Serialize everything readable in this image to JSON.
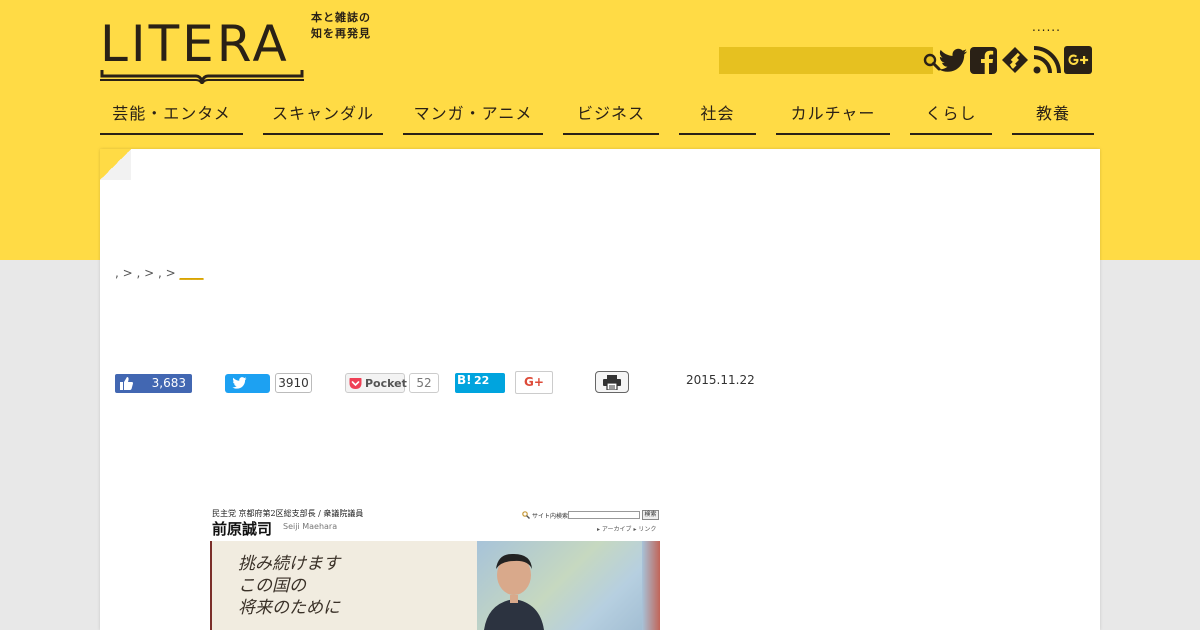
{
  "logo": {
    "word": "LITERA",
    "tagline_line1": "本と雑誌の",
    "tagline_line2": "知を再発見"
  },
  "header": {
    "dots": "......",
    "search_placeholder": ""
  },
  "social_icons": [
    "twitter-icon",
    "facebook-icon",
    "feedly-icon",
    "rss-icon",
    "google-plus-icon"
  ],
  "nav": {
    "items": [
      {
        "label": "芸能・エンタメ"
      },
      {
        "label": "スキャンダル"
      },
      {
        "label": "マンガ・アニメ"
      },
      {
        "label": "ビジネス"
      },
      {
        "label": "社会"
      },
      {
        "label": "カルチャー"
      },
      {
        "label": "くらし"
      },
      {
        "label": "教養"
      }
    ]
  },
  "breadcrumb": {
    "separator1": " > ",
    "separator2": " > ",
    "separator3": " > ",
    "comma": ",",
    "current": "____"
  },
  "share": {
    "like_count": "3,683",
    "tweet_count": "3910",
    "pocket_label": "Pocket",
    "pocket_count": "52",
    "hatena_b": "B!",
    "hatena_count": "22",
    "gplus_label": "G+"
  },
  "article": {
    "date": "2015.11.22"
  },
  "article_image": {
    "party_line": "民主党 京都府第2区総支部長 / 衆議院議員",
    "name": "前原誠司",
    "roman": "Seiji Maehara",
    "search_label": "サイト内検索",
    "search_button": "検索",
    "links": "▸ アーカイブ  ▸ リンク",
    "copy_line1": "挑み続けます",
    "copy_line2": "この国の",
    "copy_line3": "将来のために"
  },
  "colors": {
    "brand_yellow": "#ffdb45",
    "dark": "#2a2116",
    "facebook": "#4267b2",
    "twitter": "#1da1f2",
    "hatena": "#00a4de",
    "gplus": "#dd4b39"
  }
}
